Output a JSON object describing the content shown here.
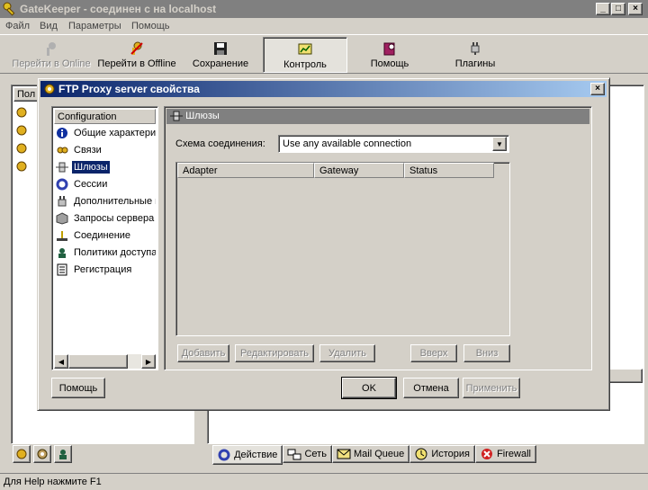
{
  "window": {
    "title": "GateKeeper - соединен с на localhost"
  },
  "menu": [
    "Файл",
    "Вид",
    "Параметры",
    "Помощь"
  ],
  "toolbar": [
    {
      "label": "Перейти в Online",
      "icon": "key-icon",
      "enabled": false
    },
    {
      "label": "Перейти в Offline",
      "icon": "key-offline-icon",
      "enabled": true
    },
    {
      "label": "Сохранение",
      "icon": "floppy-disk-icon",
      "enabled": true
    },
    {
      "label": "Контроль",
      "icon": "monitor-chart-icon",
      "enabled": true,
      "pressed": true
    },
    {
      "label": "Помощь",
      "icon": "help-book-icon",
      "enabled": true
    },
    {
      "label": "Плагины",
      "icon": "plug-icon",
      "enabled": true
    }
  ],
  "background": {
    "left_list_header": "Пол",
    "bottom_tabs": [
      {
        "label": "Действие",
        "icon": "arrows-cycle-icon"
      },
      {
        "label": "Сеть",
        "icon": "network-icon"
      },
      {
        "label": "Mail Queue",
        "icon": "envelope-icon"
      },
      {
        "label": "История",
        "icon": "clock-icon"
      },
      {
        "label": "Firewall",
        "icon": "stop-icon"
      }
    ]
  },
  "status": "Для Help нажмите F1",
  "dialog": {
    "title": "FTP Proxy server свойства",
    "tree_header": "Configuration",
    "tree_items": [
      {
        "label": "Общие характеристики",
        "icon": "info-icon"
      },
      {
        "label": "Связи",
        "icon": "links-icon"
      },
      {
        "label": "Шлюзы",
        "icon": "gateway-icon",
        "selected": true
      },
      {
        "label": "Сессии",
        "icon": "sessions-icon"
      },
      {
        "label": "Дополнительные параметры",
        "icon": "addons-icon"
      },
      {
        "label": "Запросы сервера",
        "icon": "server-requests-icon"
      },
      {
        "label": "Соединение",
        "icon": "connection-icon"
      },
      {
        "label": "Политики доступа",
        "icon": "access-policy-icon"
      },
      {
        "label": "Регистрация",
        "icon": "registration-icon"
      }
    ],
    "panel_title": "Шлюзы",
    "scheme_label": "Схема соединения:",
    "scheme_value": "Use any available connection",
    "columns": [
      "Adapter",
      "Gateway",
      "Status"
    ],
    "buttons": {
      "add": "Добавить",
      "edit": "Редактировать",
      "delete": "Удалить",
      "up": "Вверх",
      "down": "Вниз",
      "help": "Помощь",
      "ok": "OK",
      "cancel": "Отмена",
      "apply": "Применить"
    }
  }
}
